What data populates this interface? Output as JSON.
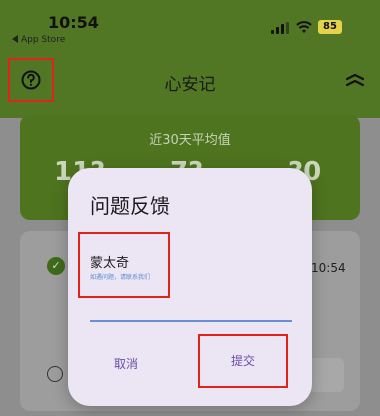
{
  "status_bar": {
    "time": "10:54",
    "back_app": "App Store",
    "battery": "85"
  },
  "app_bar": {
    "title": "心安记",
    "help_icon": "question-circle-icon",
    "menu_icon": "sort-chevrons-icon"
  },
  "background": {
    "stats_title": "近30天平均值",
    "stat_values": [
      "11?",
      "7?",
      "?0"
    ],
    "record_time_peek": "10:54"
  },
  "dialog": {
    "title": "问题反馈",
    "contact_name": "蒙太奇",
    "contact_hint": "如遇问题，请联系我们",
    "cancel_label": "取消",
    "submit_label": "提交"
  },
  "colors": {
    "app_green": "#5f8a2b",
    "highlight_red": "#e0241a",
    "dialog_bg": "#ece5f3",
    "button_text": "#6b4fa8",
    "input_line": "#6b8fd6"
  }
}
